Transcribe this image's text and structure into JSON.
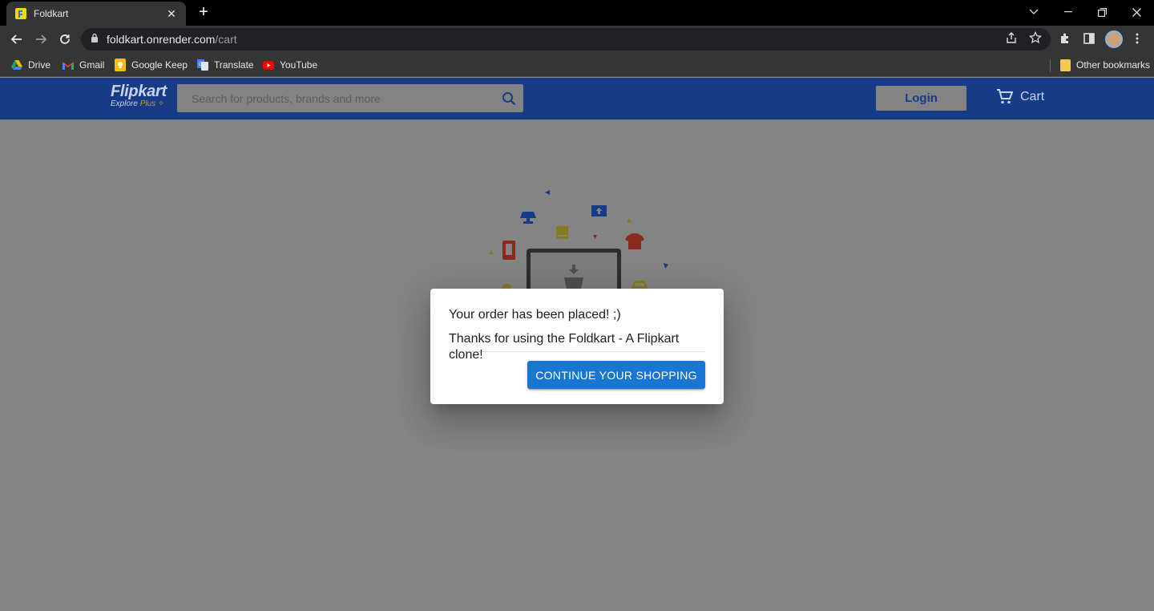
{
  "browser": {
    "tab": {
      "title": "Foldkart",
      "close": "✕"
    },
    "new_tab": "+",
    "url": {
      "host": "foldkart.onrender.com",
      "path": "/cart"
    },
    "bookmarks": [
      {
        "label": "Drive",
        "icon": "drive-icon"
      },
      {
        "label": "Gmail",
        "icon": "gmail-icon"
      },
      {
        "label": "Google Keep",
        "icon": "keep-icon"
      },
      {
        "label": "Translate",
        "icon": "translate-icon"
      },
      {
        "label": "YouTube",
        "icon": "youtube-icon"
      }
    ],
    "other_bookmarks": "Other bookmarks"
  },
  "header": {
    "logo": {
      "main": "Flipkart",
      "sub": "Explore",
      "plus": "Plus"
    },
    "search": {
      "placeholder": "Search for products, brands and more",
      "value": ""
    },
    "login_label": "Login",
    "cart_label": "Cart"
  },
  "modal": {
    "line1": "Your order has been placed! ;)",
    "line2": "Thanks for using the Foldkart - A Flipkart clone!",
    "button_label": "CONTINUE YOUR SHOPPING"
  },
  "colors": {
    "header_bg": "#173b86",
    "overlay_bg": "#848484",
    "button_primary": "#1976d2"
  }
}
